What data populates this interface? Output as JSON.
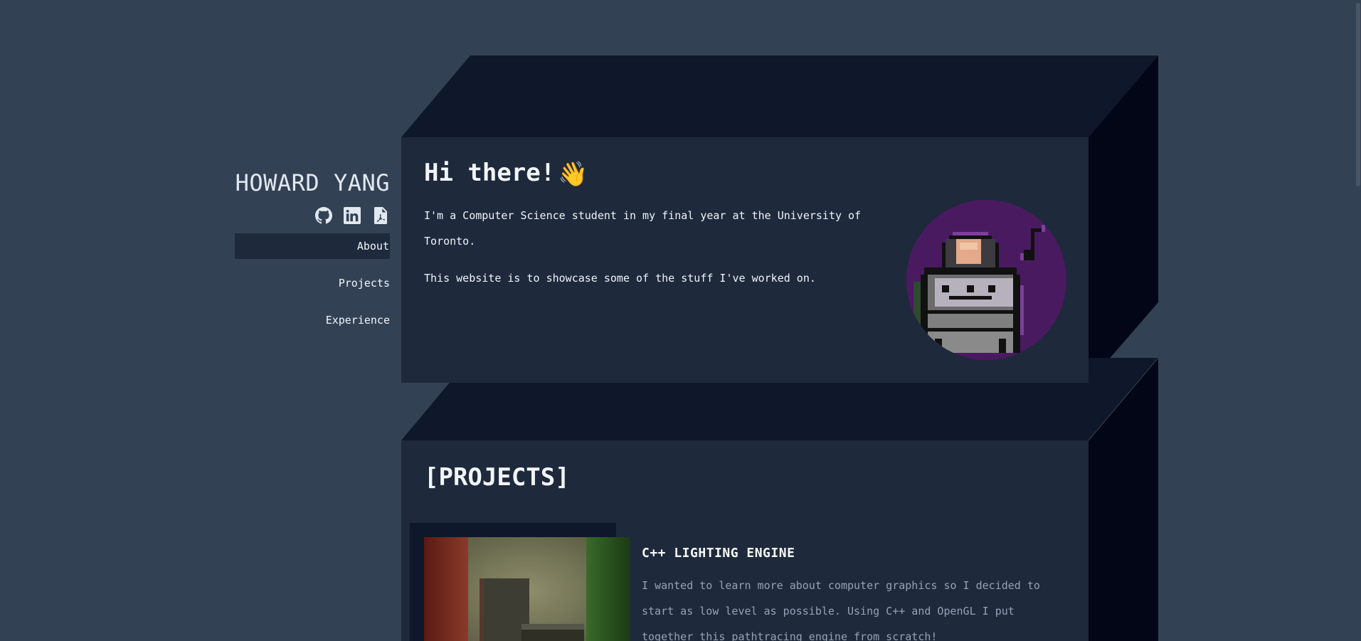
{
  "sidebar": {
    "name": "HOWARD YANG",
    "social": {
      "github_icon": "github-icon",
      "linkedin_icon": "linkedin-icon",
      "resume_icon": "pdf-icon"
    },
    "nav": [
      {
        "label": "About",
        "active": true
      },
      {
        "label": "Projects",
        "active": false
      },
      {
        "label": "Experience",
        "active": false
      }
    ]
  },
  "about": {
    "greeting": "Hi there!",
    "wave_emoji": "👋",
    "paragraphs": [
      "I'm a Computer Science student in my final year at the University of Toronto.",
      "This website is to showcase some of the stuff I've worked on."
    ]
  },
  "projects": {
    "heading": "[PROJECTS]",
    "items": [
      {
        "title": "C++ LIGHTING ENGINE",
        "description": "I wanted to learn more about computer graphics so I decided to start as low level as possible. Using C++ and OpenGL I put together this pathtracing engine from scratch!"
      }
    ]
  },
  "colors": {
    "background": "#334155",
    "card_front": "#1e293b",
    "card_top": "#0f172a",
    "card_side": "#020617",
    "text": "#f1f5f9",
    "muted_text": "#94a3b8",
    "avatar_bg": "#4a1a60"
  }
}
